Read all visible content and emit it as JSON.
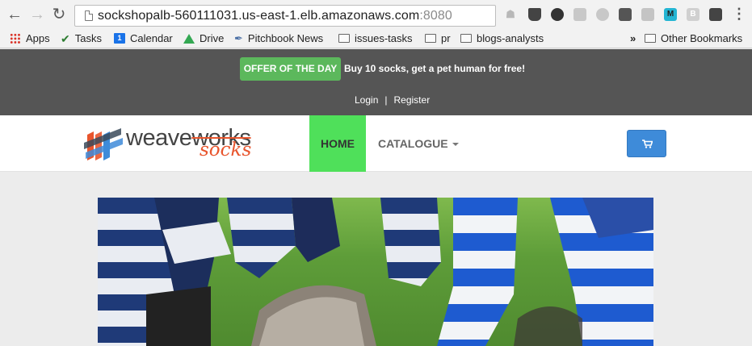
{
  "browser": {
    "url_host": "sockshopalb-560111031.us-east-1.elb.amazonaws.com",
    "url_port": ":8080",
    "extensions": [
      "ghostery-icon",
      "glass-icon",
      "refresh-circle-icon",
      "cast-icon",
      "power-icon",
      "square-icon",
      "drive-icon",
      "m-extension-icon",
      "b-extension-icon",
      "hubspot-icon"
    ],
    "extension_labels": {
      "m": "M",
      "b": "B"
    },
    "bookmarks": [
      {
        "label": "Apps",
        "icon": "apps-grid-icon"
      },
      {
        "label": "Tasks",
        "icon": "checkmark-icon"
      },
      {
        "label": "Calendar",
        "icon": "calendar-icon",
        "badge": "1"
      },
      {
        "label": "Drive",
        "icon": "drive-icon"
      },
      {
        "label": "Pitchbook News",
        "icon": "feather-icon"
      },
      {
        "label": "issues-tasks",
        "icon": "folder-icon"
      },
      {
        "label": "pr",
        "icon": "folder-icon"
      },
      {
        "label": "blogs-analysts",
        "icon": "folder-icon"
      }
    ],
    "overflow_chevron": "»",
    "other_bookmarks": "Other Bookmarks"
  },
  "topbar": {
    "offer_button": "OFFER OF THE DAY",
    "offer_text": "Buy 10 socks, get a pet human for free!",
    "login": "Login",
    "separator": "|",
    "register": "Register"
  },
  "logo": {
    "weave": "weave",
    "works": "works",
    "socks": "socks"
  },
  "nav": {
    "home": "HOME",
    "catalogue": "CATALOGUE"
  },
  "colors": {
    "topbar_bg": "#555555",
    "offer_green": "#5cb85c",
    "home_active": "#4fe05a",
    "cart_blue": "#3e8bd9",
    "logo_orange": "#e8552d"
  }
}
